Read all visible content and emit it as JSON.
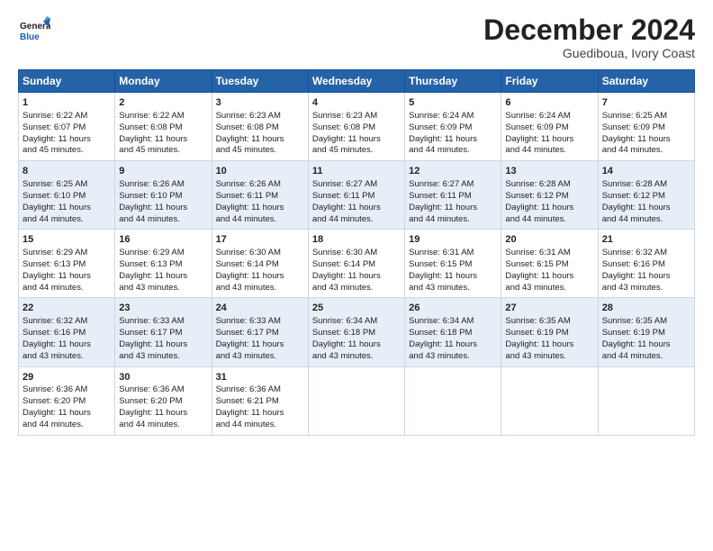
{
  "header": {
    "logo_line1": "General",
    "logo_line2": "Blue",
    "month_title": "December 2024",
    "location": "Guediboua, Ivory Coast"
  },
  "days_of_week": [
    "Sunday",
    "Monday",
    "Tuesday",
    "Wednesday",
    "Thursday",
    "Friday",
    "Saturday"
  ],
  "weeks": [
    [
      {
        "day": "1",
        "lines": [
          "Sunrise: 6:22 AM",
          "Sunset: 6:07 PM",
          "Daylight: 11 hours",
          "and 45 minutes."
        ]
      },
      {
        "day": "2",
        "lines": [
          "Sunrise: 6:22 AM",
          "Sunset: 6:08 PM",
          "Daylight: 11 hours",
          "and 45 minutes."
        ]
      },
      {
        "day": "3",
        "lines": [
          "Sunrise: 6:23 AM",
          "Sunset: 6:08 PM",
          "Daylight: 11 hours",
          "and 45 minutes."
        ]
      },
      {
        "day": "4",
        "lines": [
          "Sunrise: 6:23 AM",
          "Sunset: 6:08 PM",
          "Daylight: 11 hours",
          "and 45 minutes."
        ]
      },
      {
        "day": "5",
        "lines": [
          "Sunrise: 6:24 AM",
          "Sunset: 6:09 PM",
          "Daylight: 11 hours",
          "and 44 minutes."
        ]
      },
      {
        "day": "6",
        "lines": [
          "Sunrise: 6:24 AM",
          "Sunset: 6:09 PM",
          "Daylight: 11 hours",
          "and 44 minutes."
        ]
      },
      {
        "day": "7",
        "lines": [
          "Sunrise: 6:25 AM",
          "Sunset: 6:09 PM",
          "Daylight: 11 hours",
          "and 44 minutes."
        ]
      }
    ],
    [
      {
        "day": "8",
        "lines": [
          "Sunrise: 6:25 AM",
          "Sunset: 6:10 PM",
          "Daylight: 11 hours",
          "and 44 minutes."
        ]
      },
      {
        "day": "9",
        "lines": [
          "Sunrise: 6:26 AM",
          "Sunset: 6:10 PM",
          "Daylight: 11 hours",
          "and 44 minutes."
        ]
      },
      {
        "day": "10",
        "lines": [
          "Sunrise: 6:26 AM",
          "Sunset: 6:11 PM",
          "Daylight: 11 hours",
          "and 44 minutes."
        ]
      },
      {
        "day": "11",
        "lines": [
          "Sunrise: 6:27 AM",
          "Sunset: 6:11 PM",
          "Daylight: 11 hours",
          "and 44 minutes."
        ]
      },
      {
        "day": "12",
        "lines": [
          "Sunrise: 6:27 AM",
          "Sunset: 6:11 PM",
          "Daylight: 11 hours",
          "and 44 minutes."
        ]
      },
      {
        "day": "13",
        "lines": [
          "Sunrise: 6:28 AM",
          "Sunset: 6:12 PM",
          "Daylight: 11 hours",
          "and 44 minutes."
        ]
      },
      {
        "day": "14",
        "lines": [
          "Sunrise: 6:28 AM",
          "Sunset: 6:12 PM",
          "Daylight: 11 hours",
          "and 44 minutes."
        ]
      }
    ],
    [
      {
        "day": "15",
        "lines": [
          "Sunrise: 6:29 AM",
          "Sunset: 6:13 PM",
          "Daylight: 11 hours",
          "and 44 minutes."
        ]
      },
      {
        "day": "16",
        "lines": [
          "Sunrise: 6:29 AM",
          "Sunset: 6:13 PM",
          "Daylight: 11 hours",
          "and 43 minutes."
        ]
      },
      {
        "day": "17",
        "lines": [
          "Sunrise: 6:30 AM",
          "Sunset: 6:14 PM",
          "Daylight: 11 hours",
          "and 43 minutes."
        ]
      },
      {
        "day": "18",
        "lines": [
          "Sunrise: 6:30 AM",
          "Sunset: 6:14 PM",
          "Daylight: 11 hours",
          "and 43 minutes."
        ]
      },
      {
        "day": "19",
        "lines": [
          "Sunrise: 6:31 AM",
          "Sunset: 6:15 PM",
          "Daylight: 11 hours",
          "and 43 minutes."
        ]
      },
      {
        "day": "20",
        "lines": [
          "Sunrise: 6:31 AM",
          "Sunset: 6:15 PM",
          "Daylight: 11 hours",
          "and 43 minutes."
        ]
      },
      {
        "day": "21",
        "lines": [
          "Sunrise: 6:32 AM",
          "Sunset: 6:16 PM",
          "Daylight: 11 hours",
          "and 43 minutes."
        ]
      }
    ],
    [
      {
        "day": "22",
        "lines": [
          "Sunrise: 6:32 AM",
          "Sunset: 6:16 PM",
          "Daylight: 11 hours",
          "and 43 minutes."
        ]
      },
      {
        "day": "23",
        "lines": [
          "Sunrise: 6:33 AM",
          "Sunset: 6:17 PM",
          "Daylight: 11 hours",
          "and 43 minutes."
        ]
      },
      {
        "day": "24",
        "lines": [
          "Sunrise: 6:33 AM",
          "Sunset: 6:17 PM",
          "Daylight: 11 hours",
          "and 43 minutes."
        ]
      },
      {
        "day": "25",
        "lines": [
          "Sunrise: 6:34 AM",
          "Sunset: 6:18 PM",
          "Daylight: 11 hours",
          "and 43 minutes."
        ]
      },
      {
        "day": "26",
        "lines": [
          "Sunrise: 6:34 AM",
          "Sunset: 6:18 PM",
          "Daylight: 11 hours",
          "and 43 minutes."
        ]
      },
      {
        "day": "27",
        "lines": [
          "Sunrise: 6:35 AM",
          "Sunset: 6:19 PM",
          "Daylight: 11 hours",
          "and 43 minutes."
        ]
      },
      {
        "day": "28",
        "lines": [
          "Sunrise: 6:35 AM",
          "Sunset: 6:19 PM",
          "Daylight: 11 hours",
          "and 44 minutes."
        ]
      }
    ],
    [
      {
        "day": "29",
        "lines": [
          "Sunrise: 6:36 AM",
          "Sunset: 6:20 PM",
          "Daylight: 11 hours",
          "and 44 minutes."
        ]
      },
      {
        "day": "30",
        "lines": [
          "Sunrise: 6:36 AM",
          "Sunset: 6:20 PM",
          "Daylight: 11 hours",
          "and 44 minutes."
        ]
      },
      {
        "day": "31",
        "lines": [
          "Sunrise: 6:36 AM",
          "Sunset: 6:21 PM",
          "Daylight: 11 hours",
          "and 44 minutes."
        ]
      },
      {
        "day": "",
        "lines": []
      },
      {
        "day": "",
        "lines": []
      },
      {
        "day": "",
        "lines": []
      },
      {
        "day": "",
        "lines": []
      }
    ]
  ]
}
